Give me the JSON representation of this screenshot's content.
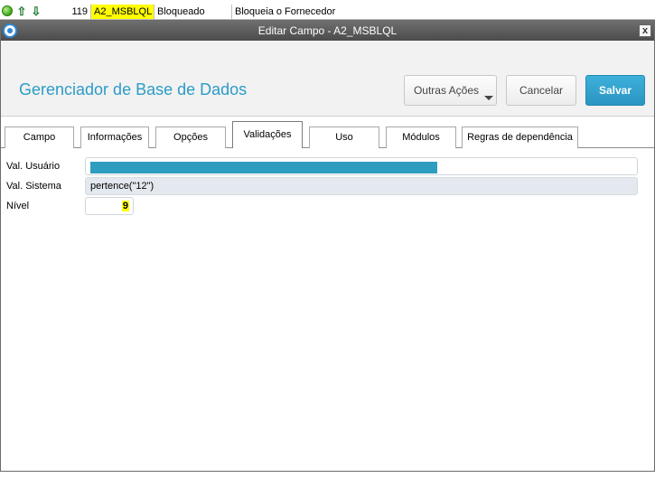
{
  "background_row": {
    "number": "119",
    "field_name": "A2_MSBLQL",
    "title": "Bloqueado",
    "description": "Bloqueia o Fornecedor",
    "up_icon": "arrow-up-icon",
    "down_icon": "arrow-down-icon",
    "status_icon": "green-status-icon"
  },
  "window": {
    "title": "Editar Campo - A2_MSBLQL",
    "close_label": "x"
  },
  "header": {
    "app_title": "Gerenciador de Base de Dados",
    "more_actions_label": "Outras Ações",
    "cancel_label": "Cancelar",
    "save_label": "Salvar"
  },
  "tabs": [
    {
      "label": "Campo",
      "active": false
    },
    {
      "label": "Informações",
      "active": false
    },
    {
      "label": "Opções",
      "active": false
    },
    {
      "label": "Validações",
      "active": true
    },
    {
      "label": "Uso",
      "active": false
    },
    {
      "label": "Módulos",
      "active": false
    },
    {
      "label": "Regras de dependência",
      "active": false
    }
  ],
  "form": {
    "user_validation_label": "Val. Usuário",
    "user_validation_value": "",
    "system_validation_label": "Val. Sistema",
    "system_validation_value": "pertence(\"12\")",
    "level_label": "Nível",
    "level_value": "9"
  },
  "colors": {
    "accent": "#2c9cc7",
    "save_button": "#2a95c1",
    "highlight": "#ffff00",
    "titlebar": "#555555"
  }
}
